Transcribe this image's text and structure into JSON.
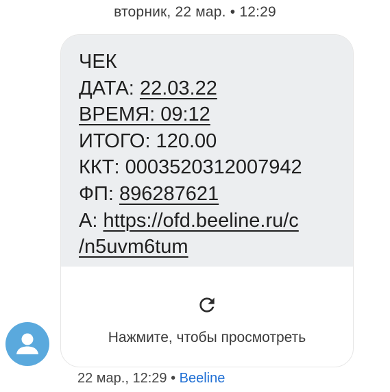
{
  "header": {
    "date": "вторник, 22 мар. • 12:29"
  },
  "message": {
    "lines": [
      {
        "prefix": "ЧЕК",
        "link": ""
      },
      {
        "prefix": "ДАТА: ",
        "link": "22.03.22"
      },
      {
        "prefix": "",
        "link": "ВРЕМЯ: 09:12"
      },
      {
        "prefix": "ИТОГО: 120.00",
        "link": ""
      },
      {
        "prefix": "ККТ: 0003520312007942",
        "link": ""
      },
      {
        "prefix": "ФП: ",
        "link": "896287621"
      },
      {
        "prefix": "А: ",
        "link": "https://ofd.beeline.ru/c"
      },
      {
        "prefix": "",
        "link": "/n5uvm6tum"
      }
    ]
  },
  "preview": {
    "icon": "refresh-icon",
    "label": "Нажмите, чтобы просмотреть"
  },
  "avatar": {
    "icon": "person-icon",
    "color": "#5aa9dd"
  },
  "footer": {
    "time": "22 мар., 12:29 • ",
    "sender": "Beeline",
    "sender_color": "#1f6fd4"
  }
}
